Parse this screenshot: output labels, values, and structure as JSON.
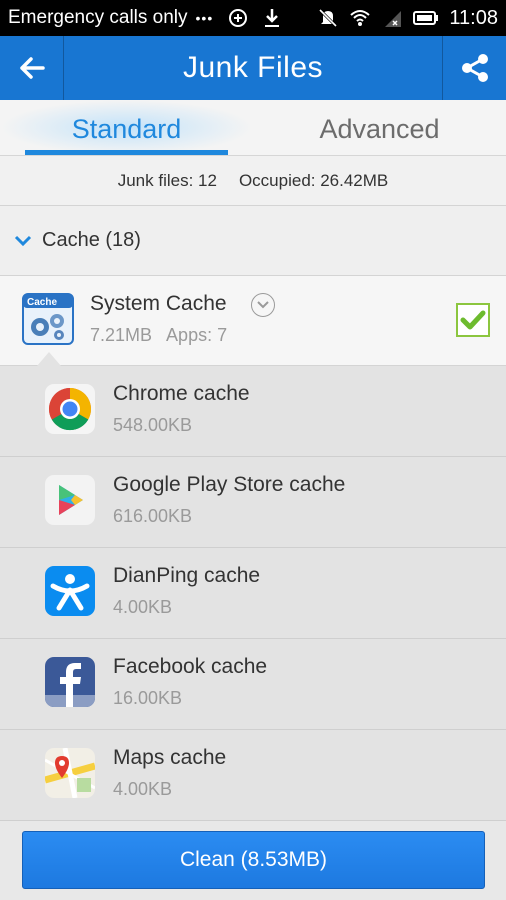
{
  "status_bar": {
    "carrier": "Emergency calls only",
    "dots": "•••",
    "time": "11:08",
    "icons": [
      "nfc-icon",
      "download-icon",
      "mute-icon",
      "wifi-icon",
      "signal-icon",
      "battery-icon"
    ]
  },
  "app_bar": {
    "title": "Junk Files",
    "back_icon": "back-arrow-icon",
    "share_icon": "share-icon"
  },
  "tabs": [
    {
      "label": "Standard",
      "active": true
    },
    {
      "label": "Advanced",
      "active": false
    }
  ],
  "summary": {
    "junk_files": "Junk files: 12",
    "occupied": "Occupied: 26.42MB"
  },
  "category": {
    "label": "Cache (18)"
  },
  "system_cache": {
    "icon_text": "Cache",
    "name": "System Cache",
    "size": "7.21MB",
    "apps": "Apps: 7",
    "checked": true
  },
  "items": [
    {
      "name": "Chrome cache",
      "size": "548.00KB",
      "icon": "chrome-icon"
    },
    {
      "name": "Google Play Store cache",
      "size": "616.00KB",
      "icon": "play-store-icon"
    },
    {
      "name": "DianPing cache",
      "size": "4.00KB",
      "icon": "dianping-icon"
    },
    {
      "name": "Facebook cache",
      "size": "16.00KB",
      "icon": "facebook-icon"
    },
    {
      "name": "Maps cache",
      "size": "4.00KB",
      "icon": "maps-icon"
    }
  ],
  "clean_button": {
    "label": "Clean (8.53MB)"
  },
  "colors": {
    "app_bar": "#1876d2",
    "tab_active": "#1f88dd",
    "checkbox": "#8cc63f",
    "button": "#1d79e0"
  }
}
